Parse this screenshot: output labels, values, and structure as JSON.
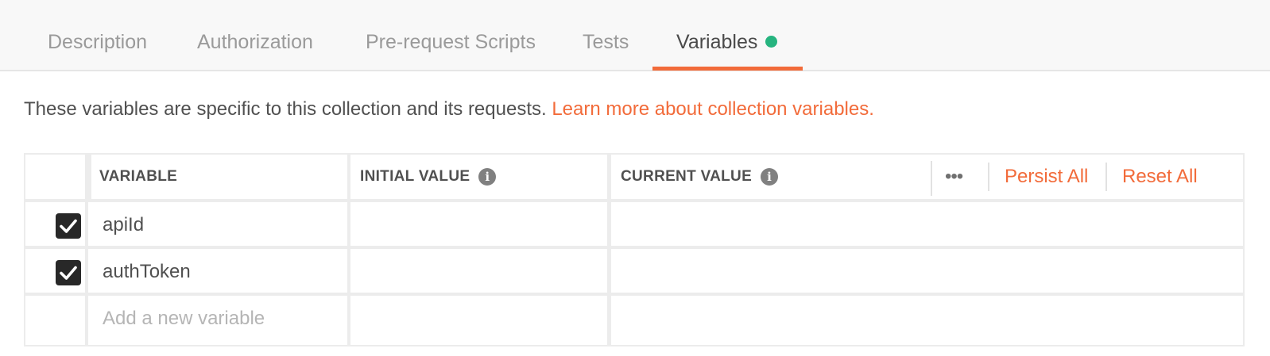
{
  "tabs": [
    {
      "label": "Description",
      "active": false
    },
    {
      "label": "Authorization",
      "active": false
    },
    {
      "label": "Pre-request Scripts",
      "active": false
    },
    {
      "label": "Tests",
      "active": false
    },
    {
      "label": "Variables",
      "active": true
    }
  ],
  "colors": {
    "accent": "#f26b3a",
    "indicator": "#26b47f"
  },
  "info": {
    "text": "These variables are specific to this collection and its requests.",
    "link": "Learn more about collection variables."
  },
  "table": {
    "headers": {
      "variable": "VARIABLE",
      "initial_value": "INITIAL VALUE",
      "current_value": "CURRENT VALUE"
    },
    "actions": {
      "more": "•••",
      "persist_all": "Persist All",
      "reset_all": "Reset All"
    },
    "rows": [
      {
        "checked": true,
        "variable": "apiId",
        "initial_value": "",
        "current_value": ""
      },
      {
        "checked": true,
        "variable": "authToken",
        "initial_value": "",
        "current_value": ""
      }
    ],
    "new_row_placeholder": "Add a new variable"
  }
}
